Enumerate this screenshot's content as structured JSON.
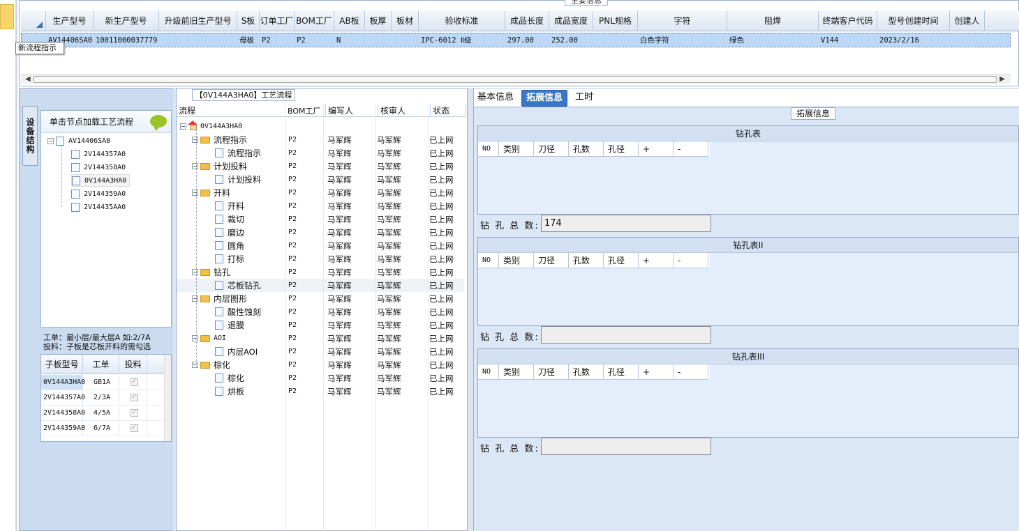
{
  "top": {
    "caption": "主要信息",
    "headers": [
      "生产型号",
      "新生产型号",
      "升级前旧生产型号",
      "S板",
      "订单工厂",
      "BOM工厂",
      "AB板",
      "板厚",
      "板材",
      "验收标准",
      "成品长度",
      "成品宽度",
      "PNL规格",
      "字符",
      "阻焊",
      "终端客户代码",
      "型号创建时间",
      "创建人"
    ],
    "row": [
      "AV14406SA0",
      "10011000037779",
      "",
      "母板",
      "P2",
      "P2",
      "N",
      "",
      "",
      "IPC-6012 Ⅱ级",
      "297.00",
      "252.00",
      "",
      "白色字符",
      "绿色",
      "V144",
      "2023/2/16",
      ""
    ],
    "tooltip": "新流程指示"
  },
  "left": {
    "vertical_tab": "设备结构",
    "tree_header": "单击节点加载工艺流程",
    "tree": {
      "root": "AV14406SA0",
      "children": [
        "2V144357A0",
        "2V144358A0",
        "0V144A3HA0",
        "2V144359A0",
        "2V14435AA0"
      ]
    },
    "hint_line1": "工单：最小层/最大层A 如:2/7A",
    "hint_line2": "投料：子板是芯板开料的需勾选",
    "sub_headers": [
      "子板型号",
      "工单",
      "投料"
    ],
    "sub_rows": [
      {
        "model": "0V144A3HA0",
        "work": "GB1A",
        "check": "✓"
      },
      {
        "model": "2V144357A0",
        "work": "2/3A",
        "check": "✓"
      },
      {
        "model": "2V144358A0",
        "work": "4/5A",
        "check": "✓"
      },
      {
        "model": "2V144359A0",
        "work": "6/7A",
        "check": "✓"
      }
    ]
  },
  "middle": {
    "caption": "【0V144A3HA0】工艺流程",
    "headers": [
      "流程",
      "BOM工厂",
      "编写人",
      "核审人",
      "状态"
    ],
    "root": "0V144A3HA0",
    "rows": [
      {
        "name": "流程指示",
        "level": 1,
        "type": "folder",
        "bom": "P2",
        "writer": "马军辉",
        "reviewer": "马军辉",
        "status": "已上网"
      },
      {
        "name": "流程指示",
        "level": 2,
        "type": "doc",
        "bom": "P2",
        "writer": "马军辉",
        "reviewer": "马军辉",
        "status": "已上网"
      },
      {
        "name": "计划投料",
        "level": 1,
        "type": "folder",
        "bom": "P2",
        "writer": "马军辉",
        "reviewer": "马军辉",
        "status": "已上网"
      },
      {
        "name": "计划投料",
        "level": 2,
        "type": "doc",
        "bom": "P2",
        "writer": "马军辉",
        "reviewer": "马军辉",
        "status": "已上网"
      },
      {
        "name": "开料",
        "level": 1,
        "type": "folder",
        "bom": "P2",
        "writer": "马军辉",
        "reviewer": "马军辉",
        "status": "已上网"
      },
      {
        "name": "开料",
        "level": 2,
        "type": "doc",
        "bom": "P2",
        "writer": "马军辉",
        "reviewer": "马军辉",
        "status": "已上网"
      },
      {
        "name": "裁切",
        "level": 2,
        "type": "doc",
        "bom": "P2",
        "writer": "马军辉",
        "reviewer": "马军辉",
        "status": "已上网"
      },
      {
        "name": "磨边",
        "level": 2,
        "type": "doc",
        "bom": "P2",
        "writer": "马军辉",
        "reviewer": "马军辉",
        "status": "已上网"
      },
      {
        "name": "圆角",
        "level": 2,
        "type": "doc",
        "bom": "P2",
        "writer": "马军辉",
        "reviewer": "马军辉",
        "status": "已上网"
      },
      {
        "name": "打标",
        "level": 2,
        "type": "doc",
        "bom": "P2",
        "writer": "马军辉",
        "reviewer": "马军辉",
        "status": "已上网"
      },
      {
        "name": "钻孔",
        "level": 1,
        "type": "folder",
        "bom": "P2",
        "writer": "马军辉",
        "reviewer": "马军辉",
        "status": "已上网"
      },
      {
        "name": "芯板钻孔",
        "level": 2,
        "type": "doc",
        "bom": "P2",
        "writer": "马军辉",
        "reviewer": "马军辉",
        "status": "已上网"
      },
      {
        "name": "内层图形",
        "level": 1,
        "type": "folder",
        "bom": "P2",
        "writer": "马军辉",
        "reviewer": "马军辉",
        "status": "已上网"
      },
      {
        "name": "酸性蚀刻",
        "level": 2,
        "type": "doc",
        "bom": "P2",
        "writer": "马军辉",
        "reviewer": "马军辉",
        "status": "已上网"
      },
      {
        "name": "退膜",
        "level": 2,
        "type": "doc",
        "bom": "P2",
        "writer": "马军辉",
        "reviewer": "马军辉",
        "status": "已上网"
      },
      {
        "name": "AOI",
        "level": 1,
        "type": "folder",
        "bom": "P2",
        "writer": "马军辉",
        "reviewer": "马军辉",
        "status": "已上网"
      },
      {
        "name": "内层AOI",
        "level": 2,
        "type": "doc",
        "bom": "P2",
        "writer": "马军辉",
        "reviewer": "马军辉",
        "status": "已上网"
      },
      {
        "name": "棕化",
        "level": 1,
        "type": "folder",
        "bom": "P2",
        "writer": "马军辉",
        "reviewer": "马军辉",
        "status": "已上网"
      },
      {
        "name": "棕化",
        "level": 2,
        "type": "doc",
        "bom": "P2",
        "writer": "马军辉",
        "reviewer": "马军辉",
        "status": "已上网"
      },
      {
        "name": "烘板",
        "level": 2,
        "type": "doc",
        "bom": "P2",
        "writer": "马军辉",
        "reviewer": "马军辉",
        "status": "已上网"
      }
    ]
  },
  "right": {
    "tabs": [
      "基本信息",
      "拓展信息",
      "工时"
    ],
    "active_tab": "拓展信息",
    "section_caption": "拓展信息",
    "table_headers": [
      "NO",
      "类别",
      "刀径",
      "孔数",
      "孔径",
      "+",
      "-"
    ],
    "tables": [
      {
        "title": "钻孔表",
        "total_label": "钻 孔 总 数:",
        "total_value": "174"
      },
      {
        "title": "钻孔表II",
        "total_label": "钻 孔 总 数:",
        "total_value": ""
      },
      {
        "title": "钻孔表III",
        "total_label": "钻 孔 总 数:",
        "total_value": ""
      }
    ]
  },
  "colors": {
    "selection": "#bcd8f6",
    "active_tab": "#3b76c7",
    "panel_bg": "#dce7f5",
    "folder": "#f0c04a"
  }
}
